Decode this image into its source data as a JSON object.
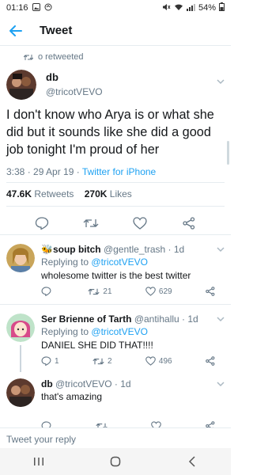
{
  "status_bar": {
    "time": "01:16",
    "battery": "54%",
    "icons": [
      "gallery-icon",
      "sync-icon",
      "mute-icon",
      "wifi-icon",
      "signal-icon",
      "battery-icon"
    ]
  },
  "app_bar": {
    "title": "Tweet",
    "back_icon": "arrow-left-icon"
  },
  "main_tweet": {
    "retweeted_label": "o retweeted",
    "author_name": "db",
    "author_handle": "@tricotVEVO",
    "text": "I don't know who Arya is or what she did but it sounds like she did a good job tonight I'm proud of her",
    "time": "3:38",
    "date": "29 Apr 19",
    "source": "Twitter for iPhone",
    "retweets_count": "47.6K",
    "retweets_label": "Retweets",
    "likes_count": "270K",
    "likes_label": "Likes"
  },
  "replies": [
    {
      "name": "🐝soup bitch",
      "handle": "@gentle_trash",
      "age": "1d",
      "replying_label": "Replying to",
      "replying_to": "@tricotVEVO",
      "text": "wholesome twitter is the best twitter",
      "reply_count": "",
      "retweet_count": "21",
      "like_count": "629"
    },
    {
      "name": "Ser Brienne of Tarth",
      "handle": "@antihallu",
      "age": "1d",
      "replying_label": "Replying to",
      "replying_to": "@tricotVEVO",
      "text": "DANIEL SHE DID THAT!!!!",
      "reply_count": "1",
      "retweet_count": "2",
      "like_count": "496"
    },
    {
      "name": "db",
      "handle": "@tricotVEVO",
      "age": "1d",
      "text": "that's amazing",
      "reply_count": "",
      "retweet_count": "",
      "like_count": ""
    }
  ],
  "composer": {
    "placeholder": "Tweet your reply"
  },
  "nav": {
    "icons": [
      "recent-apps-icon",
      "home-icon",
      "back-icon"
    ]
  },
  "colors": {
    "accent": "#1da1f2",
    "muted": "#657786",
    "text": "#14171a",
    "divider": "#e6ecf0"
  }
}
